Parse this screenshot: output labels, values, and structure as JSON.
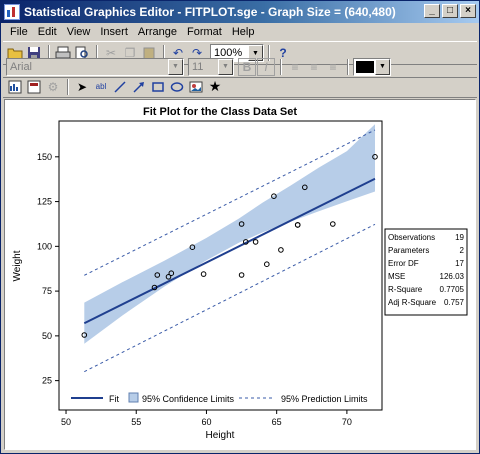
{
  "window": {
    "title": "Statistical Graphics Editor - FITPLOT.sge - Graph Size = (640,480)",
    "controls": [
      "_",
      "□",
      "×"
    ]
  },
  "menu": [
    "File",
    "Edit",
    "View",
    "Insert",
    "Arrange",
    "Format",
    "Help"
  ],
  "toolbar": {
    "zoom": "100%",
    "font_name": "Arial",
    "font_size": "11",
    "bold": "B",
    "italic": "I",
    "help": "?"
  },
  "chart_data": {
    "type": "scatter",
    "title": "Fit Plot for the Class Data Set",
    "xlabel": "Height",
    "ylabel": "Weight",
    "xlim": [
      49.5,
      72.5
    ],
    "ylim": [
      22,
      170
    ],
    "xticks": [
      50,
      55,
      60,
      65,
      70
    ],
    "yticks": [
      25,
      50,
      75,
      100,
      125,
      150
    ],
    "points": [
      [
        51.3,
        50.5
      ],
      [
        56.3,
        77.0
      ],
      [
        56.5,
        84.0
      ],
      [
        57.3,
        83.0
      ],
      [
        57.5,
        85.0
      ],
      [
        59.0,
        99.5
      ],
      [
        59.8,
        84.5
      ],
      [
        62.5,
        112.5
      ],
      [
        62.5,
        84.0
      ],
      [
        62.8,
        102.5
      ],
      [
        63.5,
        102.5
      ],
      [
        64.3,
        90.0
      ],
      [
        64.8,
        128.0
      ],
      [
        65.3,
        98.0
      ],
      [
        66.5,
        112.0
      ],
      [
        66.5,
        112.0
      ],
      [
        67.0,
        133.0
      ],
      [
        69.0,
        112.5
      ],
      [
        72.0,
        150.0
      ]
    ],
    "fit": {
      "intercept": -143.03,
      "slope": 3.9
    },
    "confidence_band": {
      "x": [
        51.3,
        54,
        57,
        60,
        62.3,
        64,
        66,
        68,
        70,
        72
      ],
      "lower": [
        45.6,
        61.3,
        77.5,
        92.2,
        102.0,
        107.8,
        113.8,
        119.6,
        125.2,
        130.6
      ],
      "upper": [
        68.6,
        79.9,
        91.9,
        104.7,
        115.5,
        124.4,
        134.0,
        144.0,
        153.2,
        168.2
      ]
    },
    "prediction_limits": {
      "x": [
        51.3,
        72.0
      ],
      "lower": [
        30.0,
        112.3
      ],
      "upper": [
        83.8,
        165.0
      ]
    },
    "legend": [
      "Fit",
      "95% Confidence Limits",
      "95% Prediction Limits"
    ],
    "stats": [
      {
        "label": "Observations",
        "value": "19"
      },
      {
        "label": "Parameters",
        "value": "2"
      },
      {
        "label": "Error DF",
        "value": "17"
      },
      {
        "label": "MSE",
        "value": "126.03"
      },
      {
        "label": "R-Square",
        "value": "0.7705"
      },
      {
        "label": "Adj R-Square",
        "value": "0.757"
      }
    ],
    "colors": {
      "fit": "#1f3f8f",
      "band": "#b7cde8",
      "prediction": "#3a5ba8",
      "marker": "#000000"
    }
  }
}
